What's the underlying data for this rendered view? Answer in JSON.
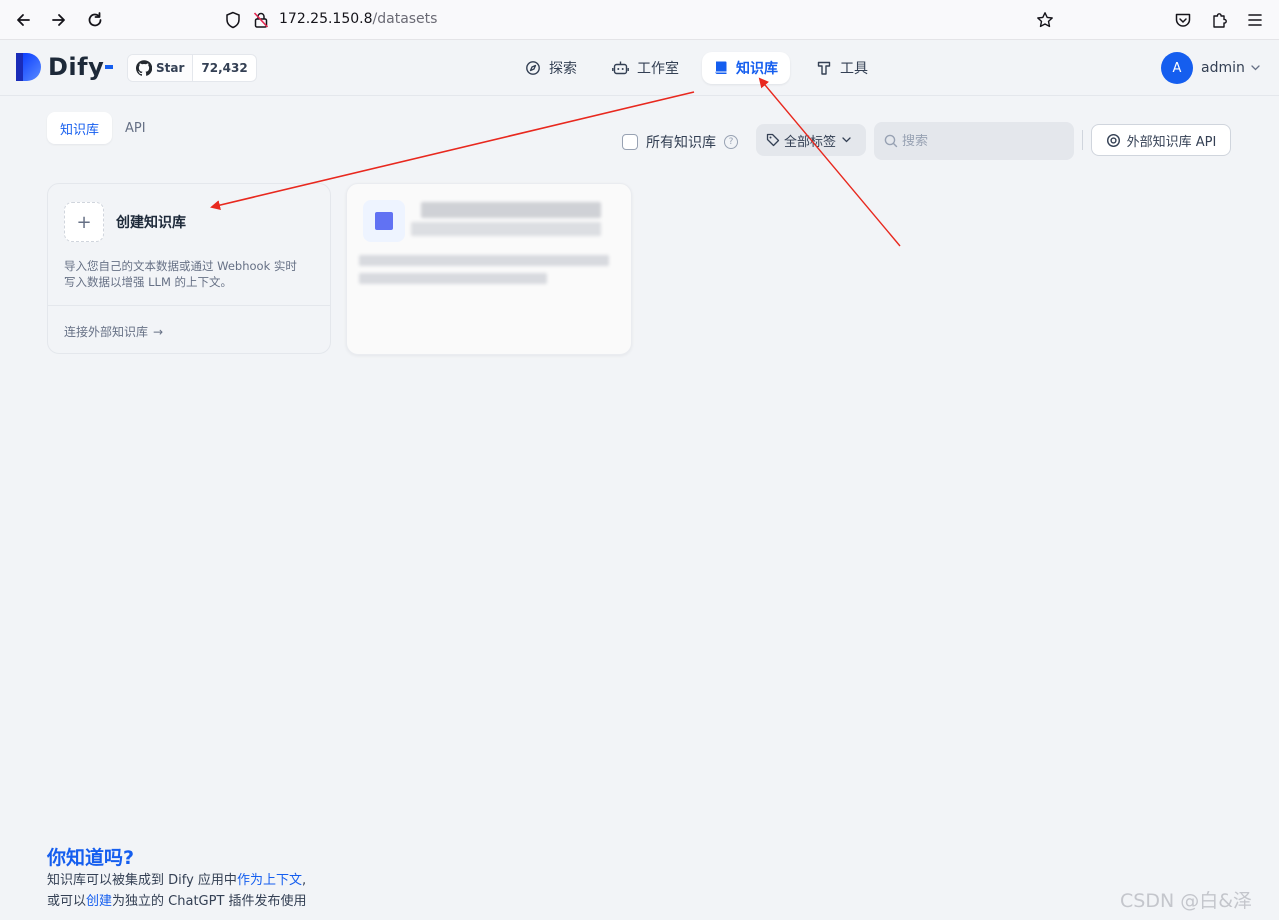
{
  "browser": {
    "url_host": "172.25.150.8",
    "url_path": "/datasets"
  },
  "app": {
    "logo_text": "Dify",
    "github": {
      "star_label": "Star",
      "count": "72,432"
    },
    "nav": [
      {
        "label": "探索",
        "icon": "compass-icon"
      },
      {
        "label": "工作室",
        "icon": "robot-icon"
      },
      {
        "label": "知识库",
        "icon": "book-icon",
        "active": true
      },
      {
        "label": "工具",
        "icon": "hammer-icon"
      }
    ],
    "user": {
      "initial": "A",
      "name": "admin"
    }
  },
  "tabs": [
    {
      "label": "知识库",
      "active": true
    },
    {
      "label": "API",
      "active": false
    }
  ],
  "filters": {
    "all_label": "所有知识库",
    "tag_select": "全部标签",
    "search_placeholder": "搜索",
    "external_api_button": "外部知识库 API"
  },
  "create_card": {
    "plus": "+",
    "title": "创建知识库",
    "desc_line1": "导入您自己的文本数据或通过 Webhook 实时",
    "desc_line2": "写入数据以增强 LLM 的上下文。",
    "link": "连接外部知识库",
    "arrow": "→"
  },
  "tip": {
    "title": "你知道吗?",
    "line1_prefix": "知识库可以被集成到 Dify 应用中",
    "line1_link": "作为上下文",
    "line1_suffix": ",",
    "line2_prefix": "或可以",
    "line2_link": "创建",
    "line2_suffix": "为独立的 ChatGPT 插件发布使用"
  },
  "watermark": "CSDN @白&泽",
  "colors": {
    "accent": "#155eef",
    "annotation": "#e8281e",
    "background": "#f2f4f7"
  }
}
